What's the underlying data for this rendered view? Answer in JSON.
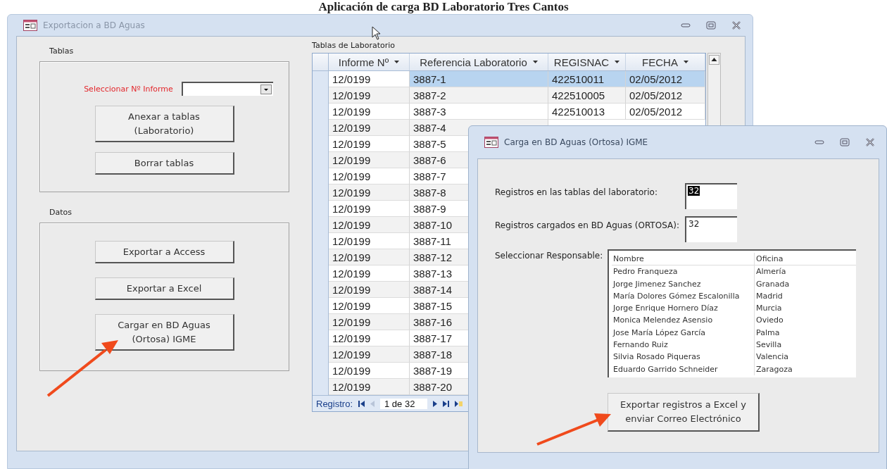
{
  "heading": "Aplicación de carga BD Laboratorio Tres Cantos",
  "main_window": {
    "title": "Exportacion a BD Aguas",
    "groups": [
      {
        "label": "Tablas",
        "selector": {
          "label": "Seleccionar Nº Informe"
        },
        "buttons": [
          {
            "lines": [
              "Anexar a tablas",
              "(Laboratorio)"
            ]
          },
          {
            "lines": [
              "Borrar tablas"
            ]
          }
        ]
      },
      {
        "label": "Datos",
        "buttons": [
          {
            "lines": [
              "Exportar a Access"
            ]
          },
          {
            "lines": [
              "Exportar a Excel"
            ]
          },
          {
            "lines": [
              "Cargar en BD Aguas",
              "(Ortosa) IGME"
            ]
          }
        ]
      }
    ],
    "datasheet": {
      "label": "Tablas de Laboratorio",
      "columns": [
        "Informe Nº",
        "Referencia Laboratorio",
        "REGISNAC",
        "FECHA"
      ],
      "rows": [
        {
          "cells": [
            "12/0199",
            "3887-1",
            "422510011",
            "02/05/2012"
          ],
          "selected": true
        },
        {
          "cells": [
            "12/0199",
            "3887-2",
            "422510005",
            "02/05/2012"
          ],
          "selected": false
        },
        {
          "cells": [
            "12/0199",
            "3887-3",
            "422510013",
            "02/05/2012"
          ],
          "selected": false
        },
        {
          "cells": [
            "12/0199",
            "3887-4"
          ],
          "selected": false
        },
        {
          "cells": [
            "12/0199",
            "3887-5"
          ],
          "selected": false
        },
        {
          "cells": [
            "12/0199",
            "3887-6"
          ],
          "selected": false
        },
        {
          "cells": [
            "12/0199",
            "3887-7"
          ],
          "selected": false
        },
        {
          "cells": [
            "12/0199",
            "3887-8"
          ],
          "selected": false
        },
        {
          "cells": [
            "12/0199",
            "3887-9"
          ],
          "selected": false
        },
        {
          "cells": [
            "12/0199",
            "3887-10"
          ],
          "selected": false
        },
        {
          "cells": [
            "12/0199",
            "3887-11"
          ],
          "selected": false
        },
        {
          "cells": [
            "12/0199",
            "3887-12"
          ],
          "selected": false
        },
        {
          "cells": [
            "12/0199",
            "3887-13"
          ],
          "selected": false
        },
        {
          "cells": [
            "12/0199",
            "3887-14"
          ],
          "selected": false
        },
        {
          "cells": [
            "12/0199",
            "3887-15"
          ],
          "selected": false
        },
        {
          "cells": [
            "12/0199",
            "3887-16"
          ],
          "selected": false
        },
        {
          "cells": [
            "12/0199",
            "3887-17"
          ],
          "selected": false
        },
        {
          "cells": [
            "12/0199",
            "3887-18"
          ],
          "selected": false
        },
        {
          "cells": [
            "12/0199",
            "3887-19"
          ],
          "selected": false
        },
        {
          "cells": [
            "12/0199",
            "3887-20"
          ],
          "selected": false
        }
      ],
      "navigator": {
        "label": "Registro:",
        "position": "1 de 32"
      }
    }
  },
  "dialog": {
    "title": "Carga en BD Aguas (Ortosa) IGME",
    "fields": [
      {
        "label": "Registros en las tablas del laboratorio:",
        "value": "32",
        "text_selected": true
      },
      {
        "label": "Registros cargados en BD Aguas (ORTOSA):",
        "value": "32",
        "text_selected": false
      }
    ],
    "responsible": {
      "label": "Seleccionar Responsable:",
      "columns": [
        "Nombre",
        "Oficina"
      ],
      "rows": [
        [
          "Pedro Franqueza",
          "Almería"
        ],
        [
          "Jorge Jimenez Sanchez",
          "Granada"
        ],
        [
          "María Dolores Gómez Escalonilla",
          "Madrid"
        ],
        [
          "Jorge Enrique Hornero Díaz",
          "Murcia"
        ],
        [
          "Monica Melendez Asensio",
          "Oviedo"
        ],
        [
          "Jose María López García",
          "Palma"
        ],
        [
          "Fernando Ruiz",
          "Sevilla"
        ],
        [
          "Silvia Rosado Piqueras",
          "Valencia"
        ],
        [
          "Eduardo Garrido Schneider",
          "Zaragoza"
        ]
      ]
    },
    "button": {
      "lines": [
        "Exportar registros a Excel y",
        "enviar Correo Electrónico"
      ]
    }
  }
}
